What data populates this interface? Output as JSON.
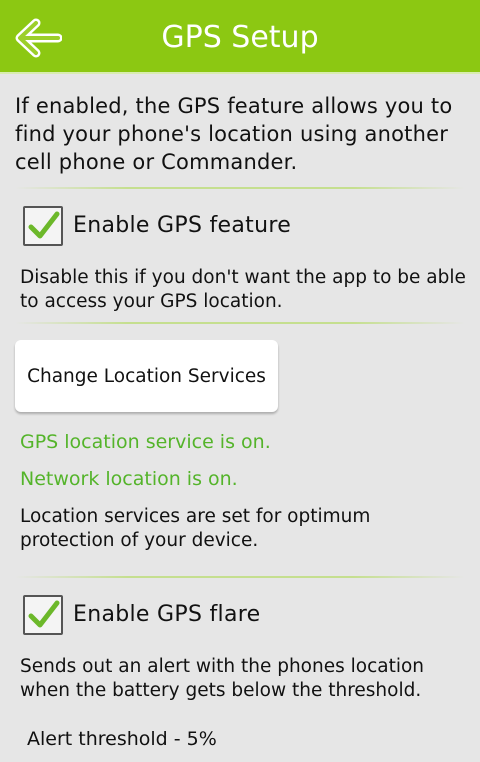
{
  "header": {
    "title": "GPS Setup",
    "back_icon": "back-arrow-icon",
    "bar_color": "#8cc812"
  },
  "intro_text": "If enabled, the GPS feature allows you to find your phone's location using another cell phone or Commander.",
  "gps_feature": {
    "label": "Enable GPS feature",
    "checked": true,
    "description": "Disable this if you don't want the app to be able to access your GPS location."
  },
  "location_services": {
    "button_label": "Change Location Services",
    "gps_status": "GPS location service is on.",
    "network_status": "Network location is on.",
    "status_color": "#54b42a",
    "summary": "Location services are set for optimum protection of your device."
  },
  "gps_flare": {
    "label": "Enable GPS flare",
    "checked": true,
    "description": "Sends out an alert with the phones location when the battery gets below the threshold."
  },
  "alert_threshold": {
    "label": "Alert threshold - 5%"
  }
}
